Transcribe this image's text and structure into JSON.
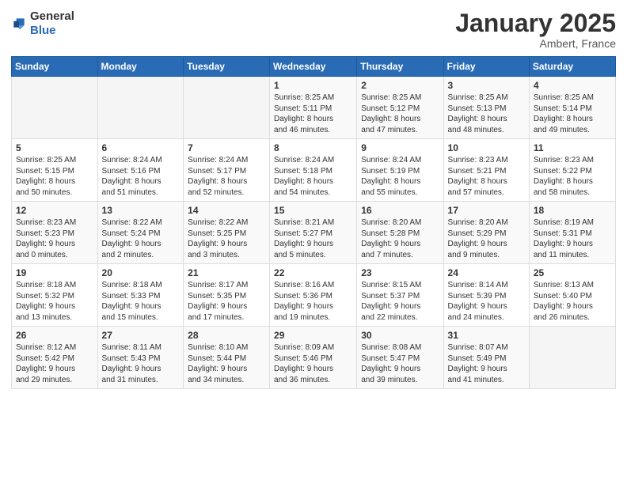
{
  "logo": {
    "general": "General",
    "blue": "Blue"
  },
  "header": {
    "month": "January 2025",
    "location": "Ambert, France"
  },
  "weekdays": [
    "Sunday",
    "Monday",
    "Tuesday",
    "Wednesday",
    "Thursday",
    "Friday",
    "Saturday"
  ],
  "weeks": [
    [
      {
        "day": "",
        "content": ""
      },
      {
        "day": "",
        "content": ""
      },
      {
        "day": "",
        "content": ""
      },
      {
        "day": "1",
        "content": "Sunrise: 8:25 AM\nSunset: 5:11 PM\nDaylight: 8 hours\nand 46 minutes."
      },
      {
        "day": "2",
        "content": "Sunrise: 8:25 AM\nSunset: 5:12 PM\nDaylight: 8 hours\nand 47 minutes."
      },
      {
        "day": "3",
        "content": "Sunrise: 8:25 AM\nSunset: 5:13 PM\nDaylight: 8 hours\nand 48 minutes."
      },
      {
        "day": "4",
        "content": "Sunrise: 8:25 AM\nSunset: 5:14 PM\nDaylight: 8 hours\nand 49 minutes."
      }
    ],
    [
      {
        "day": "5",
        "content": "Sunrise: 8:25 AM\nSunset: 5:15 PM\nDaylight: 8 hours\nand 50 minutes."
      },
      {
        "day": "6",
        "content": "Sunrise: 8:24 AM\nSunset: 5:16 PM\nDaylight: 8 hours\nand 51 minutes."
      },
      {
        "day": "7",
        "content": "Sunrise: 8:24 AM\nSunset: 5:17 PM\nDaylight: 8 hours\nand 52 minutes."
      },
      {
        "day": "8",
        "content": "Sunrise: 8:24 AM\nSunset: 5:18 PM\nDaylight: 8 hours\nand 54 minutes."
      },
      {
        "day": "9",
        "content": "Sunrise: 8:24 AM\nSunset: 5:19 PM\nDaylight: 8 hours\nand 55 minutes."
      },
      {
        "day": "10",
        "content": "Sunrise: 8:23 AM\nSunset: 5:21 PM\nDaylight: 8 hours\nand 57 minutes."
      },
      {
        "day": "11",
        "content": "Sunrise: 8:23 AM\nSunset: 5:22 PM\nDaylight: 8 hours\nand 58 minutes."
      }
    ],
    [
      {
        "day": "12",
        "content": "Sunrise: 8:23 AM\nSunset: 5:23 PM\nDaylight: 9 hours\nand 0 minutes."
      },
      {
        "day": "13",
        "content": "Sunrise: 8:22 AM\nSunset: 5:24 PM\nDaylight: 9 hours\nand 2 minutes."
      },
      {
        "day": "14",
        "content": "Sunrise: 8:22 AM\nSunset: 5:25 PM\nDaylight: 9 hours\nand 3 minutes."
      },
      {
        "day": "15",
        "content": "Sunrise: 8:21 AM\nSunset: 5:27 PM\nDaylight: 9 hours\nand 5 minutes."
      },
      {
        "day": "16",
        "content": "Sunrise: 8:20 AM\nSunset: 5:28 PM\nDaylight: 9 hours\nand 7 minutes."
      },
      {
        "day": "17",
        "content": "Sunrise: 8:20 AM\nSunset: 5:29 PM\nDaylight: 9 hours\nand 9 minutes."
      },
      {
        "day": "18",
        "content": "Sunrise: 8:19 AM\nSunset: 5:31 PM\nDaylight: 9 hours\nand 11 minutes."
      }
    ],
    [
      {
        "day": "19",
        "content": "Sunrise: 8:18 AM\nSunset: 5:32 PM\nDaylight: 9 hours\nand 13 minutes."
      },
      {
        "day": "20",
        "content": "Sunrise: 8:18 AM\nSunset: 5:33 PM\nDaylight: 9 hours\nand 15 minutes."
      },
      {
        "day": "21",
        "content": "Sunrise: 8:17 AM\nSunset: 5:35 PM\nDaylight: 9 hours\nand 17 minutes."
      },
      {
        "day": "22",
        "content": "Sunrise: 8:16 AM\nSunset: 5:36 PM\nDaylight: 9 hours\nand 19 minutes."
      },
      {
        "day": "23",
        "content": "Sunrise: 8:15 AM\nSunset: 5:37 PM\nDaylight: 9 hours\nand 22 minutes."
      },
      {
        "day": "24",
        "content": "Sunrise: 8:14 AM\nSunset: 5:39 PM\nDaylight: 9 hours\nand 24 minutes."
      },
      {
        "day": "25",
        "content": "Sunrise: 8:13 AM\nSunset: 5:40 PM\nDaylight: 9 hours\nand 26 minutes."
      }
    ],
    [
      {
        "day": "26",
        "content": "Sunrise: 8:12 AM\nSunset: 5:42 PM\nDaylight: 9 hours\nand 29 minutes."
      },
      {
        "day": "27",
        "content": "Sunrise: 8:11 AM\nSunset: 5:43 PM\nDaylight: 9 hours\nand 31 minutes."
      },
      {
        "day": "28",
        "content": "Sunrise: 8:10 AM\nSunset: 5:44 PM\nDaylight: 9 hours\nand 34 minutes."
      },
      {
        "day": "29",
        "content": "Sunrise: 8:09 AM\nSunset: 5:46 PM\nDaylight: 9 hours\nand 36 minutes."
      },
      {
        "day": "30",
        "content": "Sunrise: 8:08 AM\nSunset: 5:47 PM\nDaylight: 9 hours\nand 39 minutes."
      },
      {
        "day": "31",
        "content": "Sunrise: 8:07 AM\nSunset: 5:49 PM\nDaylight: 9 hours\nand 41 minutes."
      },
      {
        "day": "",
        "content": ""
      }
    ]
  ]
}
